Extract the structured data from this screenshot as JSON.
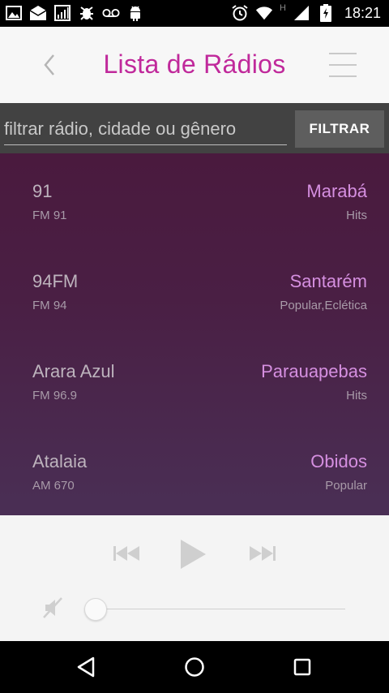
{
  "status_bar": {
    "time": "18:21",
    "network_label": "H",
    "left_icons": [
      "image-icon",
      "mail-icon",
      "signal-chart-icon",
      "android-debug-icon",
      "voicemail-icon",
      "android-icon"
    ],
    "right_icons": [
      "alarm-icon",
      "wifi-icon",
      "cell-signal-icon",
      "battery-charging-icon"
    ]
  },
  "header": {
    "title": "Lista de Rádios",
    "title_color": "#c0299b"
  },
  "filter": {
    "placeholder": "filtrar rádio, cidade ou gênero",
    "value": "",
    "button_label": "FILTRAR"
  },
  "stations": [
    {
      "name": "91",
      "frequency": "FM 91",
      "city": "Marabá",
      "genre": "Hits"
    },
    {
      "name": "94FM",
      "frequency": "FM 94",
      "city": "Santarém",
      "genre": "Popular,Eclética"
    },
    {
      "name": "Arara Azul",
      "frequency": "FM 96.9",
      "city": "Parauapebas",
      "genre": "Hits"
    },
    {
      "name": "Atalaia",
      "frequency": "AM 670",
      "city": "Obidos",
      "genre": "Popular"
    }
  ],
  "player": {
    "volume": 0,
    "muted": true
  },
  "colors": {
    "accent": "#c0299b",
    "city_text": "#d58fe0",
    "list_bg_top": "#4a1a3e",
    "list_bg_bottom": "#4a2f55"
  }
}
